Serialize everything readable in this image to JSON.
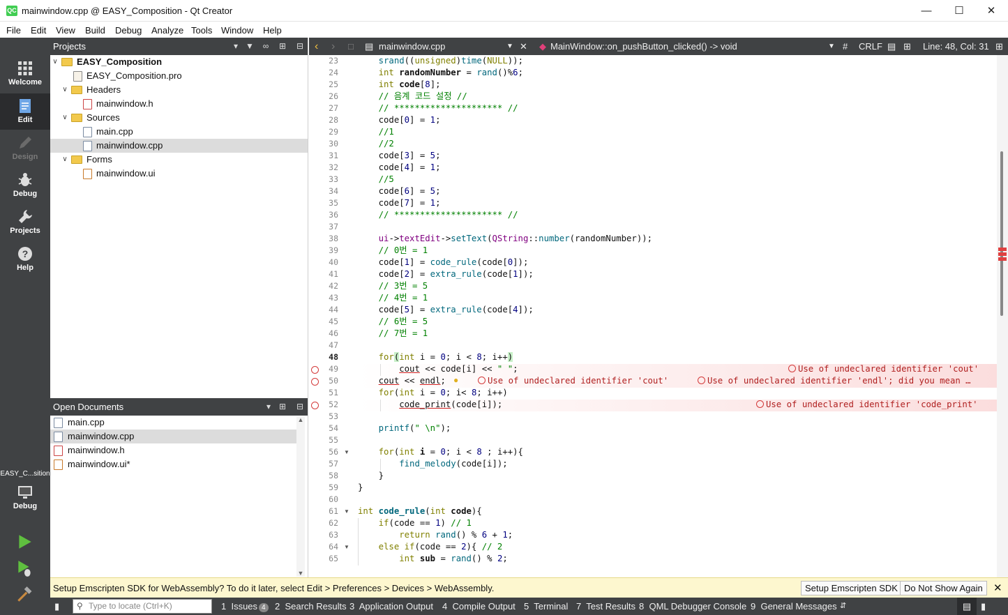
{
  "window": {
    "title": "mainwindow.cpp @ EASY_Composition - Qt Creator",
    "logo": "QC"
  },
  "menu": [
    "File",
    "Edit",
    "View",
    "Build",
    "Debug",
    "Analyze",
    "Tools",
    "Window",
    "Help"
  ],
  "modes": [
    {
      "label": "Welcome",
      "icon": "grid-icon"
    },
    {
      "label": "Edit",
      "icon": "document-icon"
    },
    {
      "label": "Design",
      "icon": "pencil-icon"
    },
    {
      "label": "Debug",
      "icon": "bug-icon"
    },
    {
      "label": "Projects",
      "icon": "wrench-icon"
    },
    {
      "label": "Help",
      "icon": "question-icon"
    }
  ],
  "kit": {
    "name": "EASY_C...sition",
    "mode": "Debug"
  },
  "projects": {
    "header": "Projects",
    "tree": [
      {
        "label": "EASY_Composition",
        "bold": true,
        "type": "project"
      },
      {
        "label": "EASY_Composition.pro",
        "type": "pro"
      },
      {
        "label": "Headers",
        "type": "folder"
      },
      {
        "label": "mainwindow.h",
        "type": "h"
      },
      {
        "label": "Sources",
        "type": "folder"
      },
      {
        "label": "main.cpp",
        "type": "cpp"
      },
      {
        "label": "mainwindow.cpp",
        "type": "cpp",
        "selected": true
      },
      {
        "label": "Forms",
        "type": "folder"
      },
      {
        "label": "mainwindow.ui",
        "type": "ui"
      }
    ]
  },
  "open_documents": {
    "header": "Open Documents",
    "items": [
      {
        "label": "main.cpp",
        "type": "cpp"
      },
      {
        "label": "mainwindow.cpp",
        "type": "cpp",
        "selected": true
      },
      {
        "label": "mainwindow.h",
        "type": "h"
      },
      {
        "label": "mainwindow.ui*",
        "type": "ui"
      }
    ]
  },
  "editor_toolbar": {
    "file": "mainwindow.cpp",
    "symbol": "MainWindow::on_pushButton_clicked() -> void",
    "hash": "#",
    "line_ending": "CRLF",
    "position": "Line: 48, Col: 31"
  },
  "code": {
    "line_numbers": [
      "23",
      "24",
      "25",
      "26",
      "27",
      "28",
      "29",
      "30",
      "31",
      "32",
      "33",
      "34",
      "35",
      "36",
      "37",
      "38",
      "39",
      "40",
      "41",
      "42",
      "43",
      "44",
      "45",
      "46",
      "47",
      "48",
      "49",
      "50",
      "51",
      "52",
      "53",
      "54",
      "55",
      "56",
      "57",
      "58",
      "59",
      "60",
      "61",
      "62",
      "63",
      "64",
      "65"
    ],
    "current_line": "48",
    "errors": [
      "Use of undeclared identifier 'cout'",
      "Use of undeclared identifier 'cout'",
      "Use of undeclared identifier 'endl'; did you mean …",
      "Use of undeclared identifier 'code_print'"
    ]
  },
  "infobar": {
    "message": "Setup Emscripten SDK for WebAssembly? To do it later, select Edit > Preferences > Devices > WebAssembly.",
    "setup_button": "Setup Emscripten SDK",
    "dismiss_button": "Do Not Show Again"
  },
  "statusbar": {
    "locate_placeholder": "Type to locate (Ctrl+K)",
    "tabs": [
      {
        "num": "1",
        "label": "Issues",
        "badge": "4"
      },
      {
        "num": "2",
        "label": "Search Results"
      },
      {
        "num": "3",
        "label": "Application Output"
      },
      {
        "num": "4",
        "label": "Compile Output"
      },
      {
        "num": "5",
        "label": "Terminal"
      },
      {
        "num": "7",
        "label": "Test Results"
      },
      {
        "num": "8",
        "label": "QML Debugger Console"
      },
      {
        "num": "9",
        "label": "General Messages"
      }
    ]
  }
}
